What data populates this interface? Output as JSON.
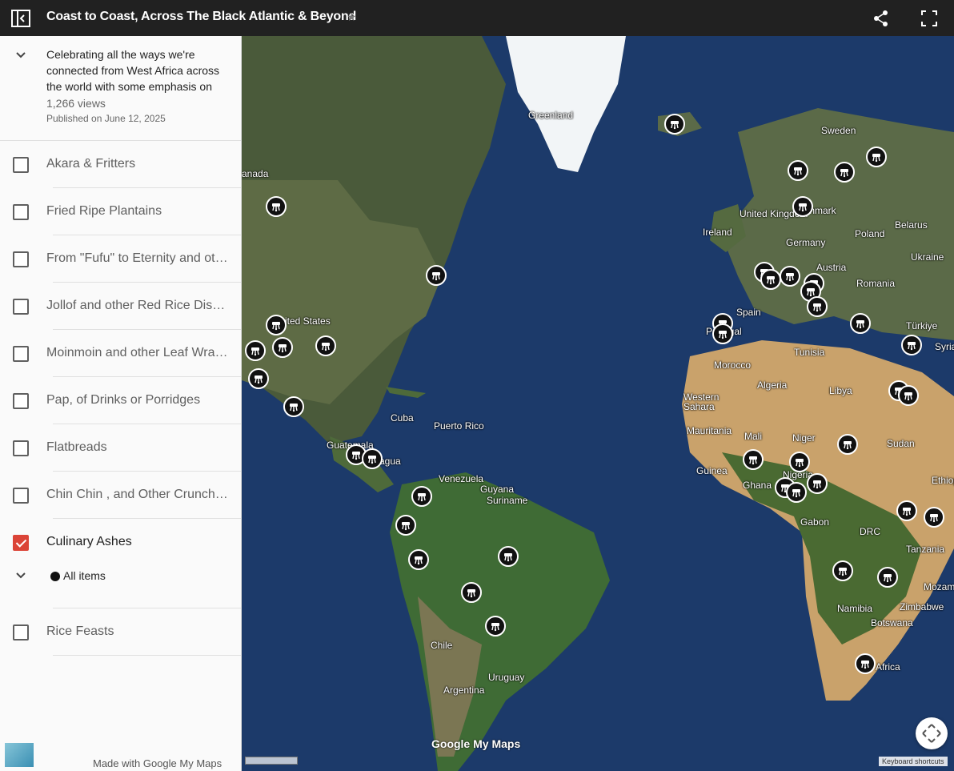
{
  "header": {
    "title": "Coast to Coast, Across The Black Atlantic & Beyond",
    "share_icon": "share-icon",
    "fullscreen_icon": "fullscreen-icon"
  },
  "sidebar": {
    "description": "Celebrating all the ways we're connected from West Africa across the world with some emphasis on",
    "views": "1,266 views",
    "published": "Published on June 12, 2025",
    "layers": [
      {
        "label": "Akara & Fritters",
        "checked": false
      },
      {
        "label": "Fried Ripe Plantains",
        "checked": false
      },
      {
        "label": "From \"Fufu\" to Eternity and other Swallow-Dishes",
        "checked": false
      },
      {
        "label": "Jollof and other Red Rice Dishes",
        "checked": false
      },
      {
        "label": "Moinmoin and other Leaf Wrapped Dishes",
        "checked": false
      },
      {
        "label": "Pap, of Drinks or Porridges",
        "checked": false
      },
      {
        "label": "Flatbreads",
        "checked": false
      },
      {
        "label": "Chin Chin , and Other Crunchy Snacks",
        "checked": false
      },
      {
        "label": "Culinary Ashes",
        "checked": true
      },
      {
        "label": "Rice Feasts",
        "checked": false
      }
    ],
    "sub_item": "All items",
    "footer": "Made with Google My Maps"
  },
  "map": {
    "labels": [
      {
        "t": "Greenland"
      },
      {
        "t": "Sweden"
      },
      {
        "t": "United Kingdom"
      },
      {
        "t": "Ireland"
      },
      {
        "t": "Germany"
      },
      {
        "t": "Poland"
      },
      {
        "t": "Belarus"
      },
      {
        "t": "Ukraine"
      },
      {
        "t": "Austria"
      },
      {
        "t": "Romania"
      },
      {
        "t": "Spain"
      },
      {
        "t": "Türkiye"
      },
      {
        "t": "Syria"
      },
      {
        "t": "Tunisia"
      },
      {
        "t": "Morocco"
      },
      {
        "t": "Algeria"
      },
      {
        "t": "Libya"
      },
      {
        "t": "Western Sahara"
      },
      {
        "t": "Mauritania"
      },
      {
        "t": "Mali"
      },
      {
        "t": "Niger"
      },
      {
        "t": "Sudan"
      },
      {
        "t": "Guinea"
      },
      {
        "t": "Ghana"
      },
      {
        "t": "Gabon"
      },
      {
        "t": "DRC"
      },
      {
        "t": "Tanzania"
      },
      {
        "t": "Namibia"
      },
      {
        "t": "Botswana"
      },
      {
        "t": "Zimbabwe"
      },
      {
        "t": "Mozamb"
      },
      {
        "t": "Ethiopi"
      },
      {
        "t": "anada"
      },
      {
        "t": "Cuba"
      },
      {
        "t": "Puerto Rico"
      },
      {
        "t": "Venezuela"
      },
      {
        "t": "Guyana"
      },
      {
        "t": "Suriname"
      },
      {
        "t": "Chile"
      },
      {
        "t": "Argentina"
      },
      {
        "t": "Uruguay"
      },
      {
        "t": "Guatemala"
      },
      {
        "t": "agua"
      },
      {
        "t": "ited States"
      },
      {
        "t": "Denmark"
      },
      {
        "t": "Portugal"
      },
      {
        "t": "Nigeria"
      },
      {
        "t": "Africa"
      }
    ],
    "keyboard_shortcuts": "Keyboard shortcuts",
    "logo": "Google My Maps",
    "marker_icon": "bbq-grill-icon",
    "marker_count": 45
  }
}
